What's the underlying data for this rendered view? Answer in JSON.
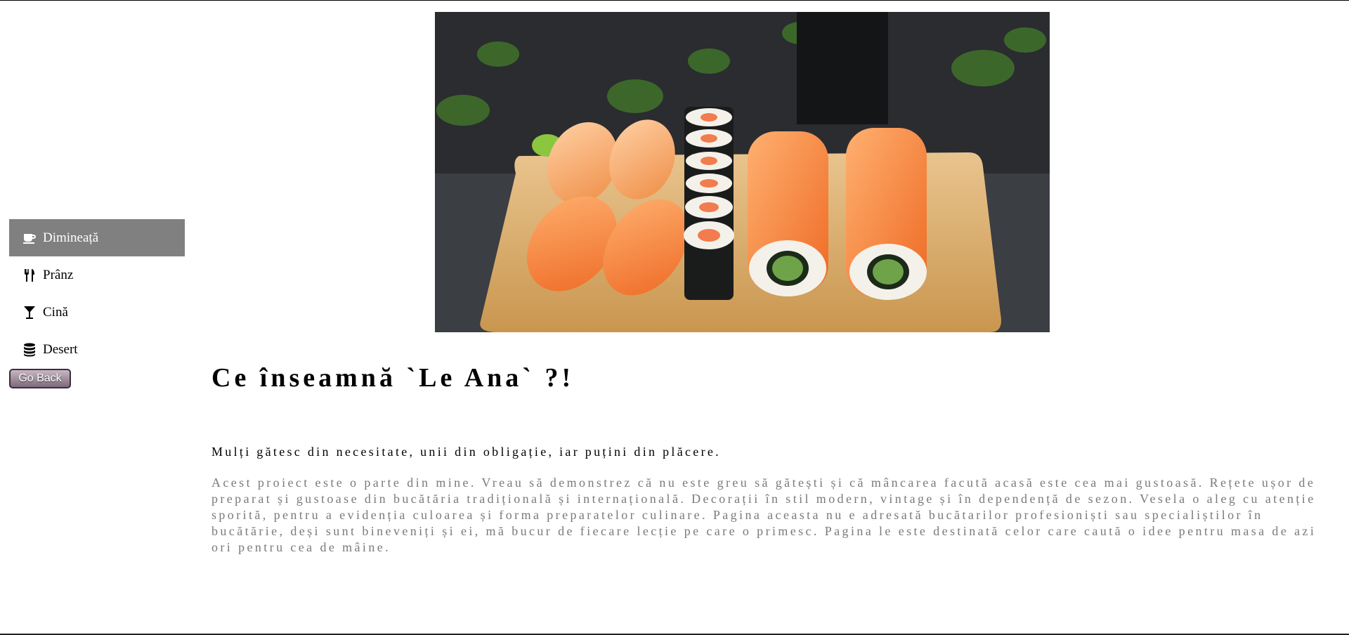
{
  "sidebar": {
    "items": [
      {
        "label": "Dimineață",
        "icon": "coffee-cup-icon",
        "active": true
      },
      {
        "label": "Prânz",
        "icon": "cutlery-icon",
        "active": false
      },
      {
        "label": "Cină",
        "icon": "cocktail-glass-icon",
        "active": false
      },
      {
        "label": "Desert",
        "icon": "database-stack-icon",
        "active": false
      }
    ],
    "go_back_label": "Go Back"
  },
  "hero": {
    "alt": "Sushi platter with salmon nigiri and rolls on a wooden board"
  },
  "content": {
    "title": "Ce înseamnă `Le Ana` ?!",
    "lead": "Mulți gătesc din necesitate, unii din obligație, iar puțini din plăcere.",
    "body": "Acest proiect este o parte din mine. Vreau să demonstrez că nu este greu să gătești și că mâncarea facută acasă este cea mai gustoasă. Rețete ușor de preparat și gustoase din bucătăria tradițională și internațională. Decorații în stil modern, vintage și în dependență de sezon. Vesela o aleg cu atenție sporită, pentru a evidenția culoarea și forma preparatelor culinare. Pagina aceasta nu e adresată bucătarilor profesioniști sau specialiștilor în bucătărie, deși sunt bineveniți și ei, mă bucur de fiecare lecție pe care o primesc. Pagina le este destinată celor care caută o idee pentru masa de azi ori pentru cea de mâine."
  },
  "colors": {
    "active_bg": "#808080",
    "body_text": "#7a7a7a"
  }
}
